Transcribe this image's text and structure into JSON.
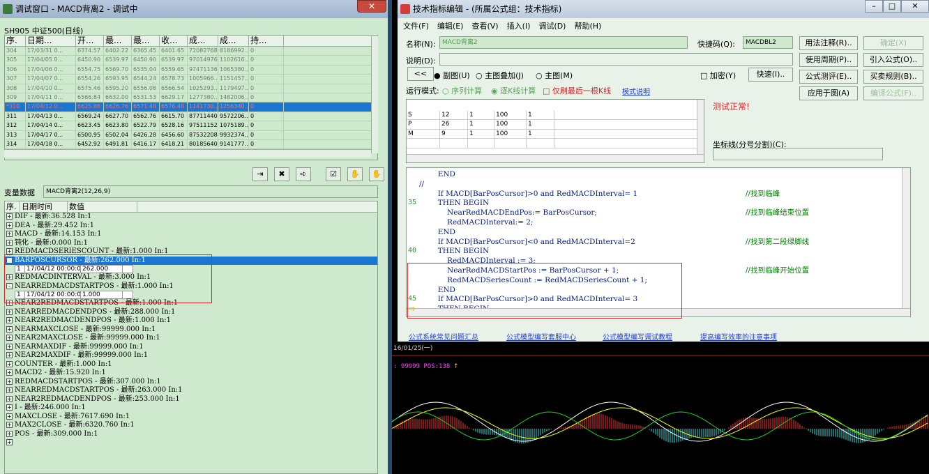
{
  "left_window": {
    "title": "调试窗口 - MACD背离2 - 调试中",
    "close_label": "✕",
    "symbol_line": "SH905 中证500(日线)",
    "columns": [
      "序.",
      "日期...",
      "开...",
      "最...",
      "最...",
      "收...",
      "成...",
      "成...",
      "持..."
    ],
    "rows": [
      {
        "style": "old",
        "cells": [
          "304",
          "17/03/31 0...",
          "6374.57",
          "6402.22",
          "6365.45",
          "6401.65",
          "72082768",
          "8186992...",
          "0"
        ]
      },
      {
        "style": "old",
        "cells": [
          "305",
          "17/04/05 0...",
          "6450.90",
          "6539.97",
          "6450.90",
          "6539.97",
          "97014976",
          "1102616...",
          "0"
        ]
      },
      {
        "style": "old",
        "cells": [
          "306",
          "17/04/06 0...",
          "6554.75",
          "6569.70",
          "6535.04",
          "6559.65",
          "97471136",
          "1065380...",
          "0"
        ]
      },
      {
        "style": "old",
        "cells": [
          "307",
          "17/04/07 0...",
          "6554.26",
          "6593.95",
          "6544.24",
          "6578.73",
          "1005966...",
          "1151457...",
          "0"
        ]
      },
      {
        "style": "old",
        "cells": [
          "308",
          "17/04/10 0...",
          "6575.46",
          "6595.20",
          "6556.08",
          "6566.54",
          "1025293...",
          "1179497...",
          "0"
        ]
      },
      {
        "style": "old",
        "cells": [
          "309",
          "17/04/11 0...",
          "6566.84",
          "6632.00",
          "6531.53",
          "6629.17",
          "1277380...",
          "1482006...",
          "0"
        ]
      },
      {
        "style": "sel",
        "cells": [
          "*310",
          "17/04/12 0...",
          "6625.88",
          "6626.76",
          "6571.48",
          "6576.48",
          "1141730...",
          "1256340...",
          "0"
        ]
      },
      {
        "style": "",
        "cells": [
          "311",
          "17/04/13 0...",
          "6569.24",
          "6627.70",
          "6562.76",
          "6615.70",
          "87711440",
          "9572206...",
          "0"
        ]
      },
      {
        "style": "",
        "cells": [
          "312",
          "17/04/14 0...",
          "6623.45",
          "6623.80",
          "6522.79",
          "6528.16",
          "97511152",
          "1075189...",
          "0"
        ]
      },
      {
        "style": "",
        "cells": [
          "313",
          "17/04/17 0...",
          "6500.95",
          "6502.04",
          "6426.28",
          "6456.60",
          "87532208",
          "9932374...",
          "0"
        ]
      },
      {
        "style": "",
        "cells": [
          "314",
          "17/04/18 0...",
          "6452.92",
          "6491.81",
          "6416.17",
          "6418.21",
          "80185640",
          "9141777...",
          "0"
        ]
      }
    ],
    "toolbar": [
      "⇥",
      "✖",
      "➪",
      "☑",
      "✋",
      "✋"
    ],
    "var_label": "变量数据",
    "var_formula": "MACD背离2(12,26,9)",
    "var_columns": [
      "序.",
      "日期时间",
      "数值"
    ],
    "vars": [
      {
        "sign": "+",
        "text": "DIF  -  最新:36.528  In:1"
      },
      {
        "sign": "+",
        "text": "DEA  -  最新:29.452  In:1"
      },
      {
        "sign": "+",
        "text": "MACD  -  最新:14.153  In:1"
      },
      {
        "sign": "+",
        "text": "钝化  -  最新:0.000  In:1"
      },
      {
        "sign": "+",
        "text": "REDMACDSERIESCOUNT  -  最新:1.000  In:1"
      },
      {
        "sign": "-",
        "text": "BARPOSCURSOR  -  最新:262.000  In:1",
        "sel": true,
        "sub": [
          "1",
          "17/04/12 00:00:00",
          "262.000"
        ]
      },
      {
        "sign": "+",
        "text": "REDMACDINTERVAL  -  最新:3.000  In:1"
      },
      {
        "sign": "-",
        "text": "NEARREDMACDSTARTPOS  -  最新:1.000  In:1",
        "sub": [
          "1",
          "17/04/12 00:00:00",
          "1.000"
        ]
      },
      {
        "sign": "+",
        "text": "NEAR2REDMACDSTARTPOS  -  最新:1.000  In:1"
      },
      {
        "sign": "+",
        "text": "NEARREDMACDENDPOS  -  最新:288.000  In:1"
      },
      {
        "sign": "+",
        "text": "NEAR2REDMACDENDPOS  -  最新:1.000  In:1"
      },
      {
        "sign": "+",
        "text": "NEARMAXCLOSE  -  最新:99999.000  In:1"
      },
      {
        "sign": "+",
        "text": "NEAR2MAXCLOSE  -  最新:99999.000  In:1"
      },
      {
        "sign": "+",
        "text": "NEARMAXDIF  -  最新:99999.000  In:1"
      },
      {
        "sign": "+",
        "text": "NEAR2MAXDIF  -  最新:99999.000  In:1"
      },
      {
        "sign": "+",
        "text": "COUNTER  -  最新:1.000  In:1"
      },
      {
        "sign": "+",
        "text": "MACD2  -  最新:15.920  In:1"
      },
      {
        "sign": "+",
        "text": "REDMACDSTARTPOS  -  最新:307.000  In:1"
      },
      {
        "sign": "+",
        "text": "NEARREDMACDSTARTPOS  -  最新:263.000  In:1"
      },
      {
        "sign": "+",
        "text": "NEAR2REDMACDENDPOS  -  最新:253.000  In:1"
      },
      {
        "sign": "+",
        "text": "I  -  最新:246.000  In:1"
      },
      {
        "sign": "+",
        "text": "MAXCLOSE  -  最新:7617.690  In:1"
      },
      {
        "sign": "+",
        "text": "MAX2CLOSE  -  最新:6320.760  In:1"
      },
      {
        "sign": "+",
        "text": "POS  -  最新:309.000  In:1"
      },
      {
        "sign": "+",
        "text": ""
      }
    ]
  },
  "right_window": {
    "title": "技术指标编辑 - (所属公式组：技术指标)",
    "menu": [
      "文件(F)",
      "编辑(E)",
      "查看(V)",
      "插入(I)",
      "调试(D)",
      "帮助(H)"
    ],
    "name_label": "名称(N):",
    "name_value": "MACD背离2",
    "shortcut_label": "快捷码(Q):",
    "shortcut_value": "MACDBL2",
    "desc_label": "说明(D):",
    "back_label": "<<",
    "radio_sub": "● 副图(U)",
    "radio_overlay": "○ 主图叠加(J)",
    "radio_main": "○ 主图(M)",
    "encrypt_label": "□ 加密(Y)",
    "quick_label": "快速(I)..",
    "mode_label": "运行模式:",
    "mode_seq": "○ 序列计算",
    "mode_bar": "◉ 逐K线计算",
    "mode_last": "□ 仅刷最后一根K线",
    "mode_help": "模式说明",
    "buttons": [
      {
        "label": "用法注释(R)..",
        "dis": false
      },
      {
        "label": "确定(X)",
        "dis": true
      },
      {
        "label": "使用周期(P)..",
        "dis": false
      },
      {
        "label": "引入公式(O)..",
        "dis": false
      },
      {
        "label": "公式测评(E)..",
        "dis": false
      },
      {
        "label": "买卖规则(B)..",
        "dis": false
      },
      {
        "label": "应用于图(A)",
        "dis": false
      },
      {
        "label": "编译公式(F)..",
        "dis": true
      }
    ],
    "params": [
      [
        "S",
        "12",
        "1",
        "100",
        "1"
      ],
      [
        "P",
        "26",
        "1",
        "100",
        "1"
      ],
      [
        "M",
        "9",
        "1",
        "100",
        "1"
      ],
      [
        "",
        "",
        "",
        "",
        ""
      ]
    ],
    "test_status": "测试正常!",
    "coord_label": "坐标线(分号分割)(C):",
    "code_lines": [
      {
        "n": "",
        "t": "        END"
      },
      {
        "n": "",
        "t": "//"
      },
      {
        "n": "",
        "t": "        If MACD[BarPosCursor]>0 and RedMACDInterval= 1",
        "c": "//找到临峰"
      },
      {
        "n": "35",
        "t": "        THEN BEGIN"
      },
      {
        "n": "",
        "t": "            NearRedMACDEndPos:= BarPosCursor;",
        "c": "//找到临峰结束位置"
      },
      {
        "n": "",
        "t": "            RedMACDInterval:= 2;"
      },
      {
        "n": "",
        "t": "        END"
      },
      {
        "n": "",
        "t": "        If MACD[BarPosCursor]<0 and RedMACDInterval=2",
        "c": "//找到第二段绿脚线"
      },
      {
        "n": "40",
        "t": "        THEN BEGIN"
      },
      {
        "n": "",
        "t": "            RedMACDInterval := 3;"
      },
      {
        "n": "",
        "t": "            NearRedMACDStartPos := BarPosCursor + 1;",
        "c": "//找到临峰开始位置"
      },
      {
        "n": "",
        "t": "            RedMACDSeriesCount := RedMACDSeriesCount + 1;"
      },
      {
        "n": "",
        "t": "        END"
      },
      {
        "n": "45",
        "t": "        If MACD[BarPosCursor]>0 and RedMACDInterval= 3"
      },
      {
        "n": "",
        "t": "        THEN BEGIN"
      }
    ],
    "links": [
      "公式系统常见问题汇总",
      "公式模型编写套服中心",
      "公式模型编写调试教程",
      "提高编写效率的注意事项"
    ]
  },
  "chart": {
    "date_label": "16/01/25(一)",
    "pos_text": ": 99999 POS:138",
    "up_arrow": "↑"
  }
}
